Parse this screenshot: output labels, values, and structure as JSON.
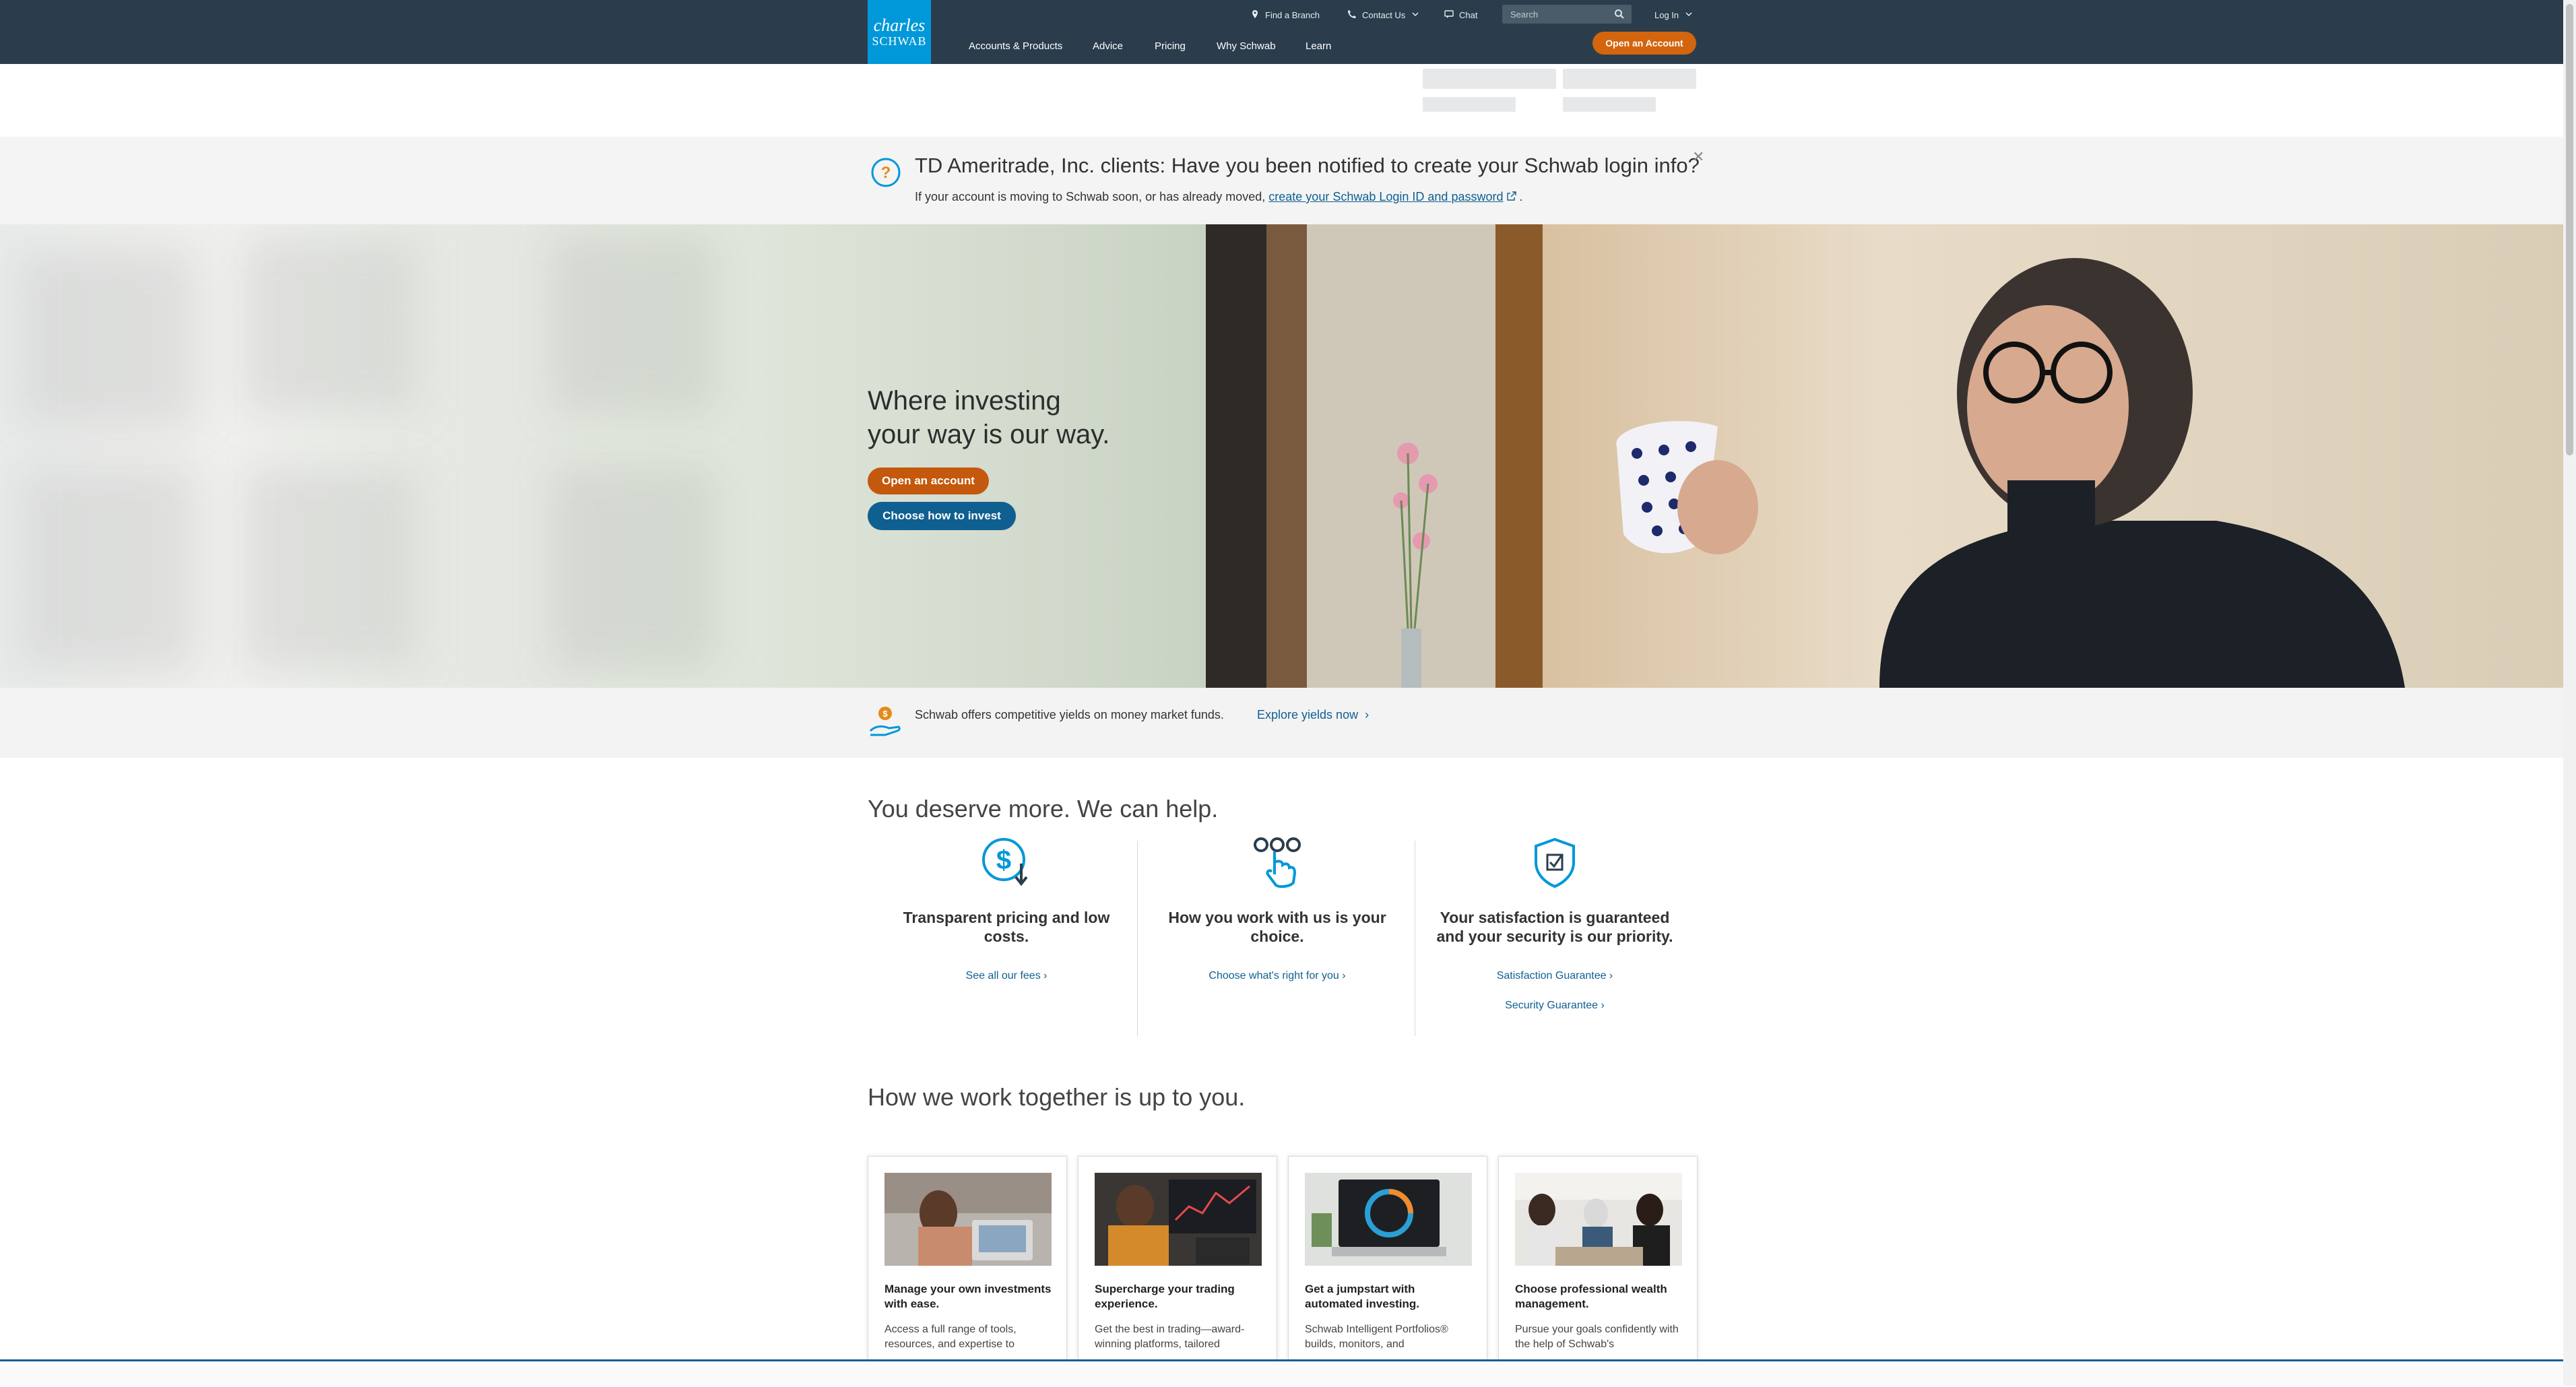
{
  "header": {
    "logo": {
      "line1": "charles",
      "line2": "SCHWAB"
    },
    "utility": {
      "find_branch": "Find a Branch",
      "contact_us": "Contact Us",
      "chat": "Chat",
      "search_placeholder": "Search",
      "log_in": "Log In"
    },
    "open_account": "Open an Account",
    "nav": [
      "Accounts & Products",
      "Advice",
      "Pricing",
      "Why Schwab",
      "Learn"
    ]
  },
  "alert": {
    "title": "TD Ameritrade, Inc. clients: Have you been notified to create your Schwab login info?",
    "body_prefix": "If your account is moving to Schwab soon, or has already moved, ",
    "link": "create your Schwab Login ID and password",
    "body_suffix": "."
  },
  "hero": {
    "headline_line1": "Where investing",
    "headline_line2": "your way is our way.",
    "primary_cta": "Open an account",
    "secondary_cta": "Choose how to invest"
  },
  "yield_banner": {
    "text": "Schwab offers competitive yields on money market funds.",
    "link": "Explore yields now"
  },
  "deserve": {
    "heading": "You deserve more. We can help.",
    "features": [
      {
        "icon": "dollar-down-icon",
        "title": "Transparent pricing and low costs.",
        "links": [
          "See all our fees"
        ]
      },
      {
        "icon": "hand-choice-icon",
        "title": "How you work with us is your choice.",
        "links": [
          "Choose what's right for you"
        ]
      },
      {
        "icon": "shield-check-icon",
        "title": "Your satisfaction is guaranteed and your security is our priority.",
        "links": [
          "Satisfaction Guarantee",
          "Security Guarantee"
        ]
      }
    ]
  },
  "together": {
    "heading": "How we work together is up to you.",
    "cards": [
      {
        "title": "Manage your own investments with ease.",
        "body": "Access a full range of tools, resources, and expertise to"
      },
      {
        "title": "Supercharge your trading experience.",
        "body": "Get the best in trading—award-winning platforms, tailored"
      },
      {
        "title": "Get a jumpstart with automated investing.",
        "body": "Schwab Intelligent Portfolios® builds, monitors, and"
      },
      {
        "title": "Choose professional wealth management.",
        "body": "Pursue your goals confidently with the help of Schwab's"
      }
    ]
  },
  "colors": {
    "header_bg": "#2b3d4c",
    "logo_bg": "#0098d8",
    "cta_orange": "#d3650e",
    "cta_blue": "#0f5f91"
  }
}
